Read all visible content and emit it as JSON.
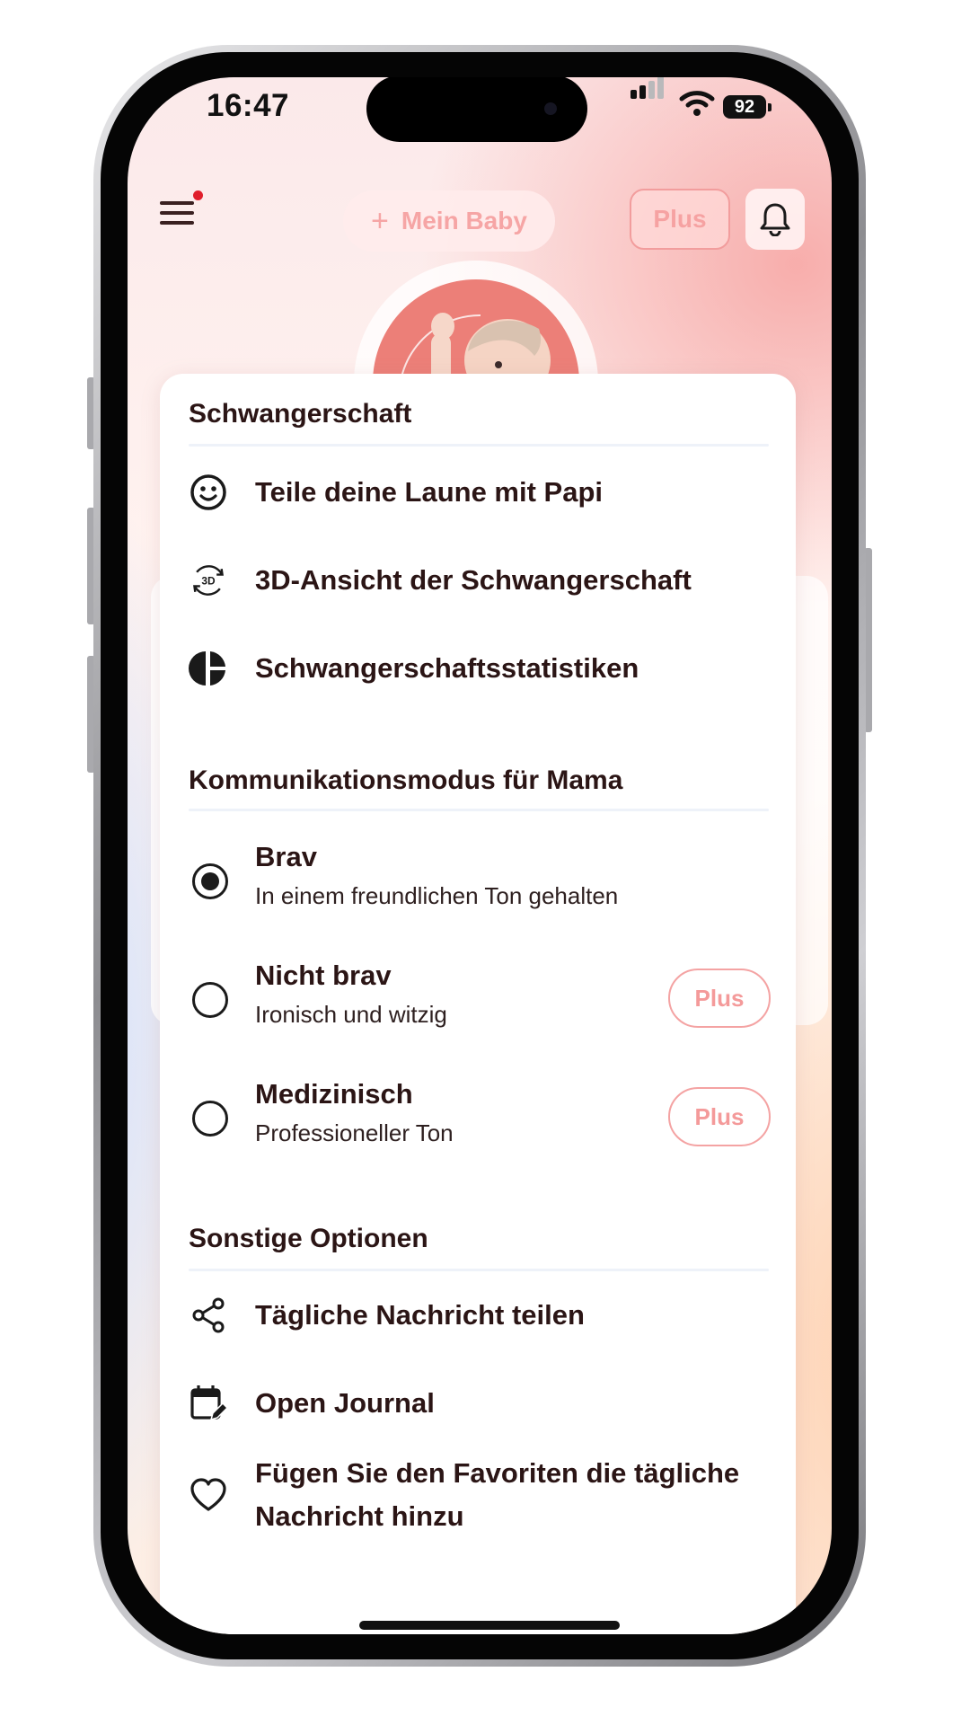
{
  "status_bar": {
    "time": "16:47",
    "battery": "92"
  },
  "header": {
    "baby_button_icon": "plus-icon",
    "baby_button_label": "Mein Baby",
    "plus_label": "Plus",
    "menu_icon": "hamburger-menu-icon",
    "notification_icon": "bell-icon"
  },
  "menu": {
    "pregnancy": {
      "title": "Schwangerschaft",
      "items": [
        {
          "icon": "smiley-face-icon",
          "label": "Teile deine Laune mit Papi"
        },
        {
          "icon": "3d-rotate-icon",
          "label": "3D-Ansicht der Schwangerschaft"
        },
        {
          "icon": "pie-chart-icon",
          "label": "Schwangerschaftsstatistiken"
        }
      ]
    },
    "communication": {
      "title": "Kommunikationsmodus für Mama",
      "options": [
        {
          "title": "Brav",
          "subtitle": "In einem freundlichen Ton gehalten",
          "selected": true
        },
        {
          "title": "Nicht brav",
          "subtitle": "Ironisch und witzig",
          "selected": false,
          "badge": "Plus"
        },
        {
          "title": "Medizinisch",
          "subtitle": "Professioneller Ton",
          "selected": false,
          "badge": "Plus"
        }
      ]
    },
    "other": {
      "title": "Sonstige Optionen",
      "items": [
        {
          "icon": "share-icon",
          "label": "Tägliche Nachricht teilen"
        },
        {
          "icon": "calendar-edit-icon",
          "label": "Open Journal"
        },
        {
          "icon": "heart-icon",
          "label_line1": "Fügen Sie den Favoriten die tägliche",
          "label_line2": "Nachricht hinzu"
        }
      ]
    }
  },
  "colors": {
    "accent": "#f29d9d",
    "text_dark": "#2b1515",
    "avatar_bg": "#ec7f78"
  }
}
